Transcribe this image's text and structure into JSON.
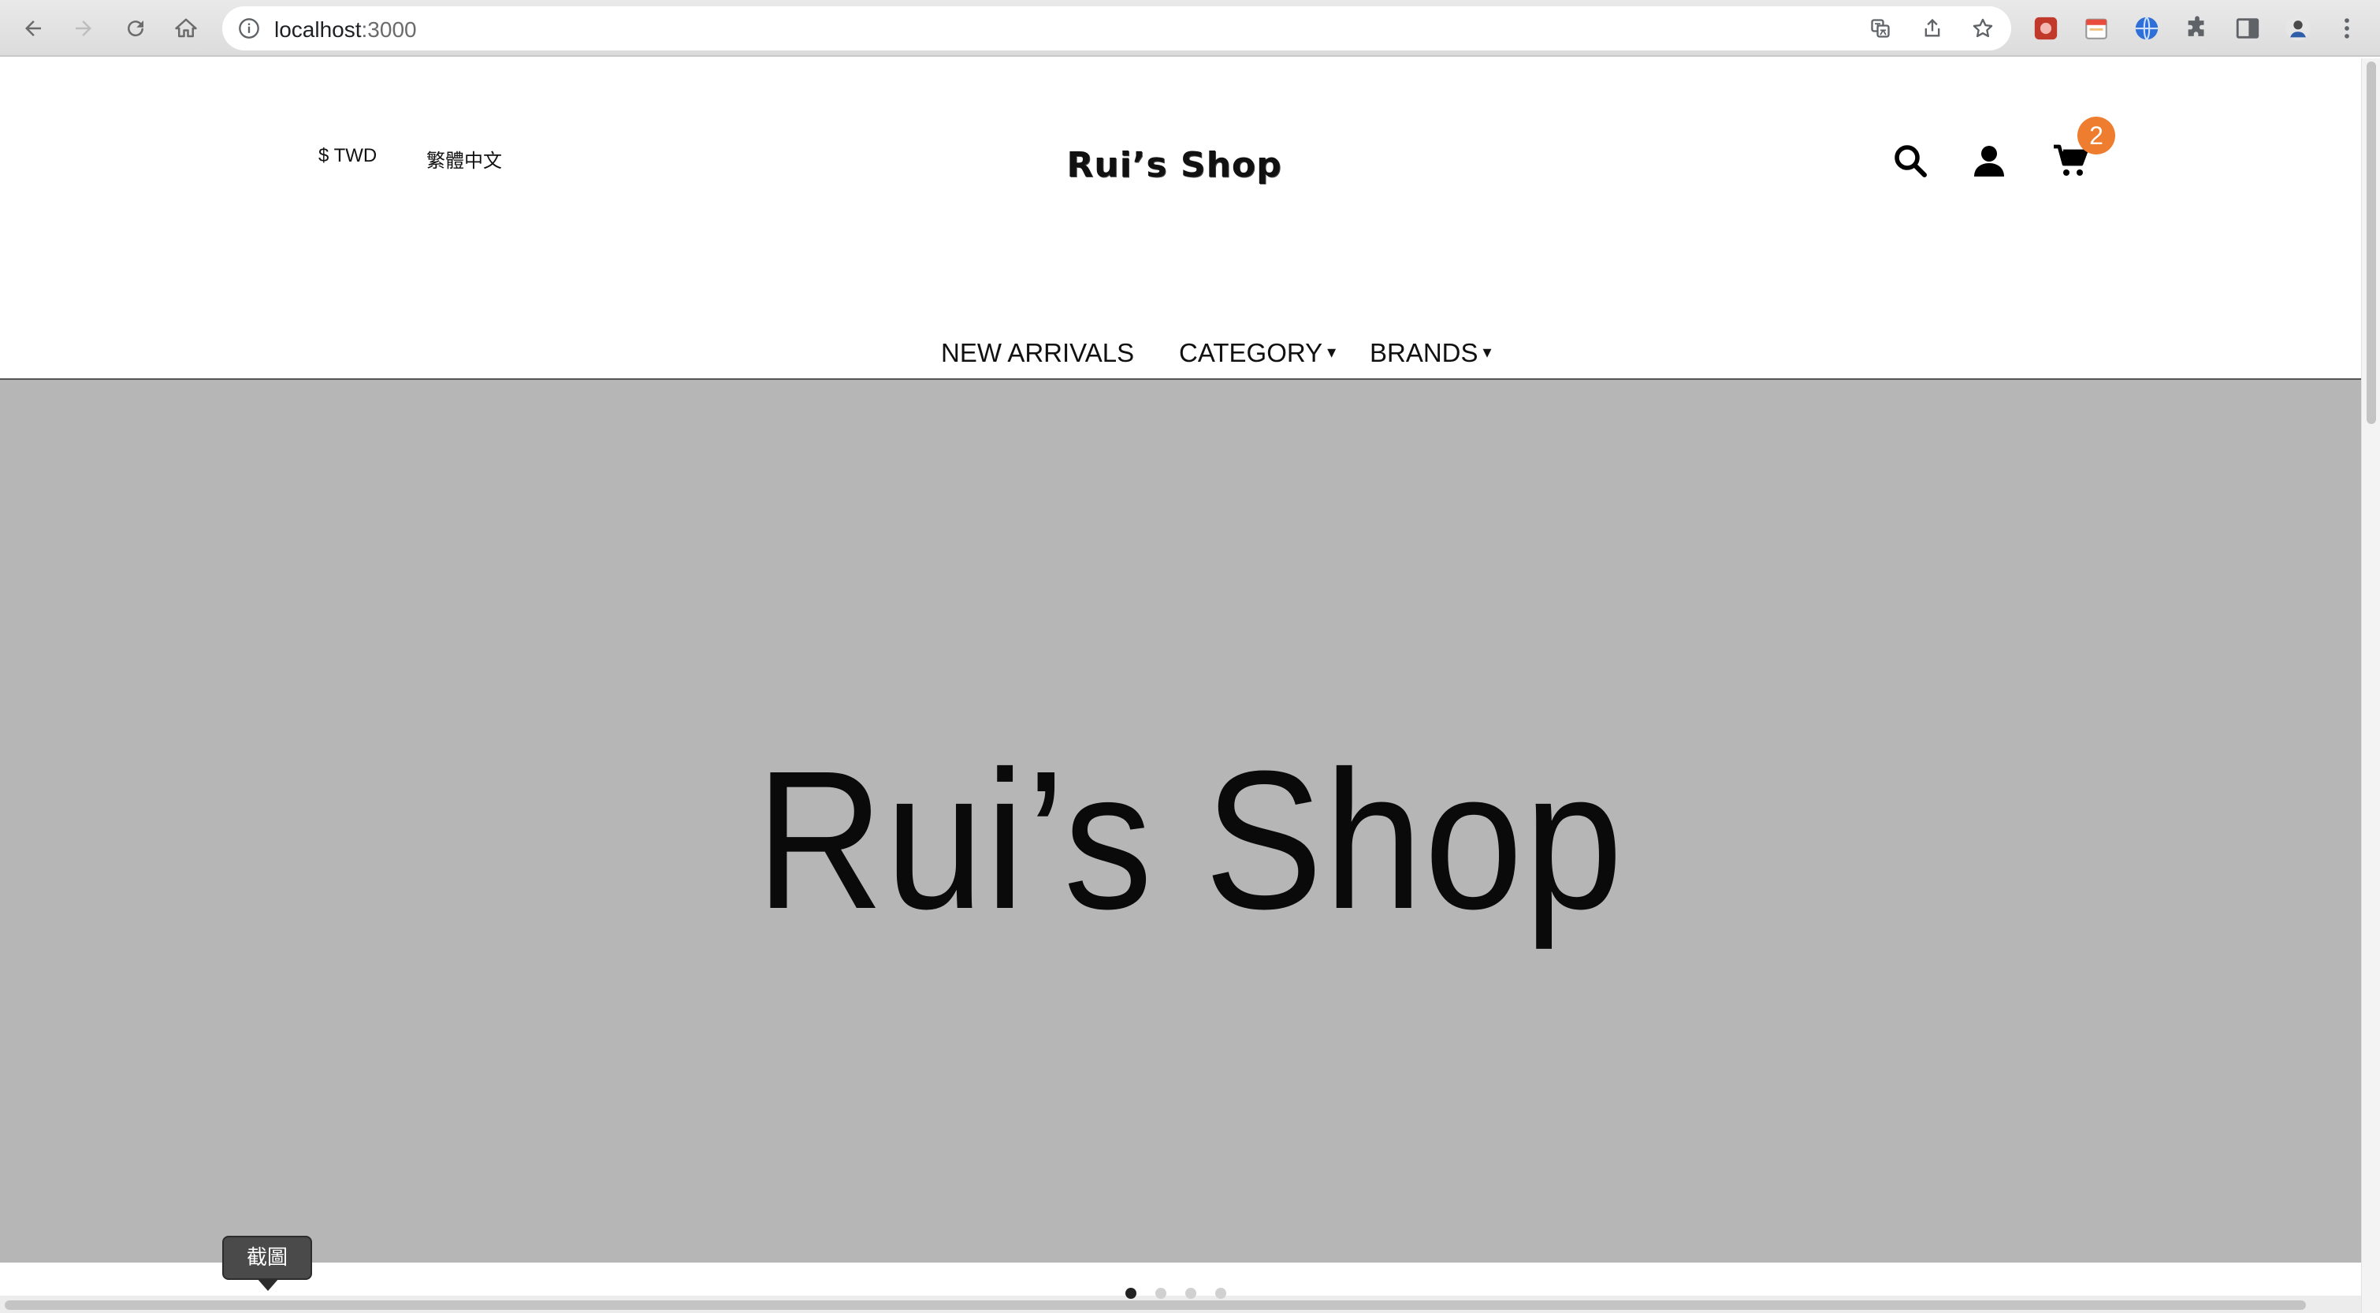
{
  "browser": {
    "url_host": "localhost",
    "url_port": ":3000",
    "icons": [
      "back-icon",
      "forward-icon",
      "reload-icon",
      "home-icon",
      "info-icon",
      "translate-icon",
      "share-icon",
      "bookmark-star-icon",
      "extension-red-icon",
      "extension-calendar-icon",
      "extension-globe-icon",
      "puzzle-icon",
      "sidebar-icon",
      "profile-avatar",
      "kebab-menu-icon"
    ]
  },
  "header": {
    "currency_label": "$ TWD",
    "language_label": "繁體中文",
    "logo_text": "Rui’s Shop",
    "cart_count": "2",
    "icons": [
      "search-icon",
      "user-icon",
      "cart-icon"
    ],
    "badge_color": "#ee7d2f"
  },
  "nav": {
    "items": [
      {
        "label": "NEW ARRIVALS",
        "has_caret": false
      },
      {
        "label": "CATEGORY",
        "has_caret": true
      },
      {
        "label": "BRANDS",
        "has_caret": true
      }
    ],
    "caret": "▾"
  },
  "hero": {
    "title": "Rui’s Shop",
    "background": "#b6b6b6",
    "slide_count": 4,
    "active_slide": 1
  },
  "tooltip": {
    "text": "截圖"
  }
}
